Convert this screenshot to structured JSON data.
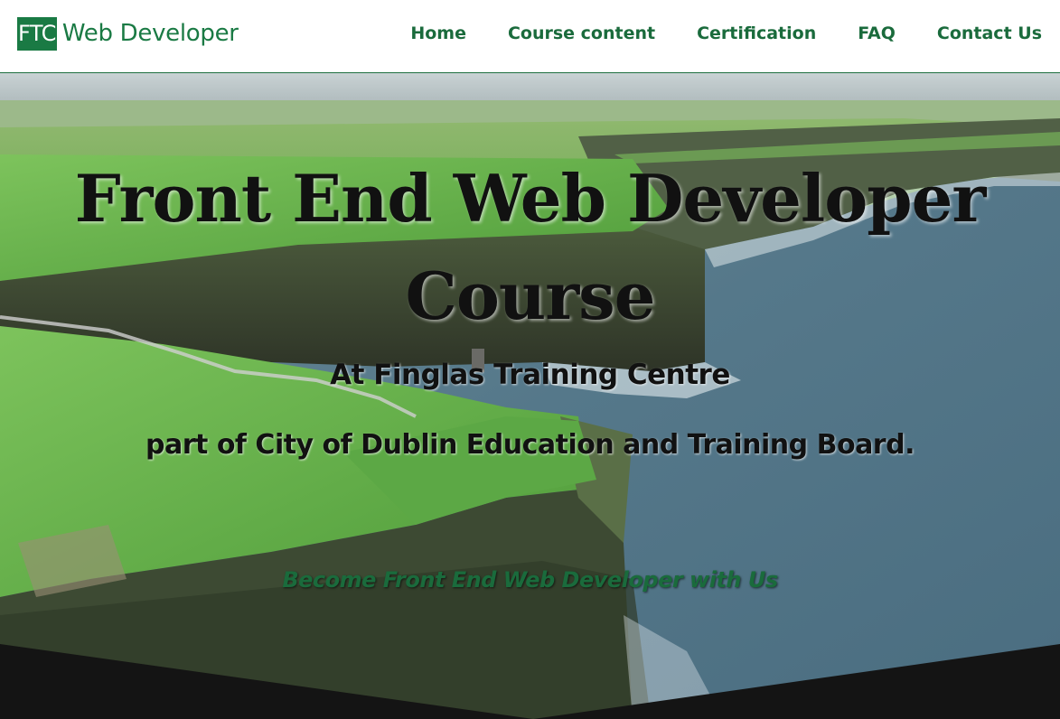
{
  "navbar": {
    "brand_logo": "FTC",
    "brand_text": "Web Developer",
    "links": [
      {
        "label": "Home"
      },
      {
        "label": "Course content"
      },
      {
        "label": "Certification"
      },
      {
        "label": "FAQ"
      },
      {
        "label": "Contact Us"
      }
    ]
  },
  "hero": {
    "title": "Front End Web Developer Course",
    "subtitle1": "At Finglas Training Centre",
    "subtitle2": "part of City of Dublin Education and Training Board.",
    "tagline": "Become Front End Web Developer with Us",
    "background_image": "cliffs-of-moher-photo"
  },
  "colors": {
    "brand_green": "#1a7a44",
    "nav_green": "#1a6b3c",
    "dark_band": "#141414"
  }
}
